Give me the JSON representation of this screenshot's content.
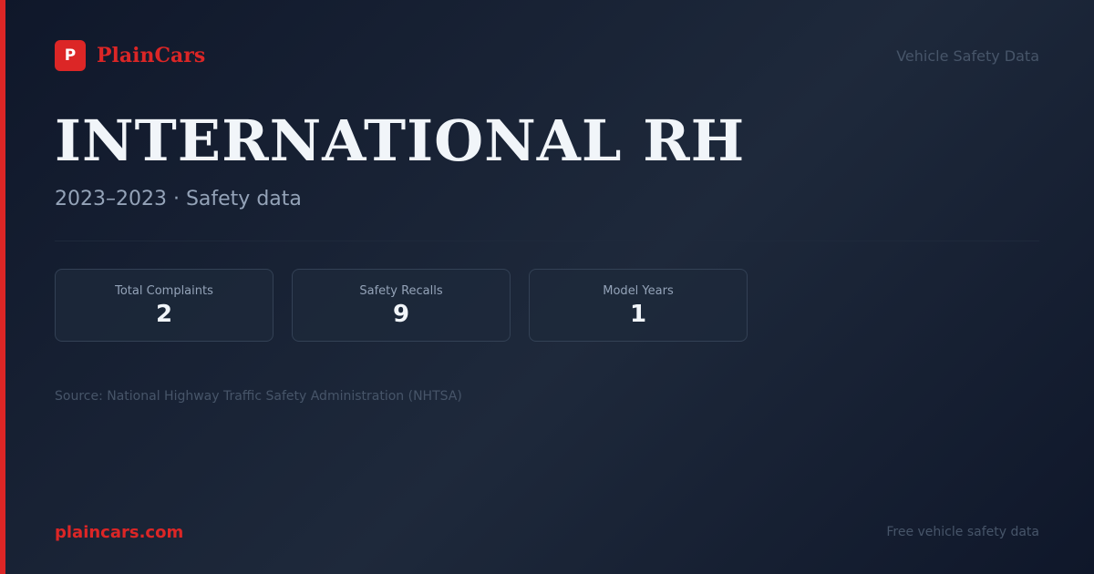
{
  "brand": {
    "logo_letter": "P",
    "name": "PlainCars",
    "tagline": "Vehicle Safety Data"
  },
  "vehicle": {
    "title": "INTERNATIONAL RH",
    "subtitle": "2023–2023 · Safety data"
  },
  "stats": [
    {
      "label": "Total Complaints",
      "value": "2"
    },
    {
      "label": "Safety Recalls",
      "value": "9"
    },
    {
      "label": "Model Years",
      "value": "1"
    }
  ],
  "source": "Source: National Highway Traffic Safety Administration (NHTSA)",
  "footer": {
    "url": "plaincars.com",
    "tagline": "Free vehicle safety data"
  },
  "colors": {
    "accent": "#dc2626",
    "background": "#0f172a",
    "text_primary": "#f1f5f9",
    "text_muted": "#94a3b8"
  }
}
